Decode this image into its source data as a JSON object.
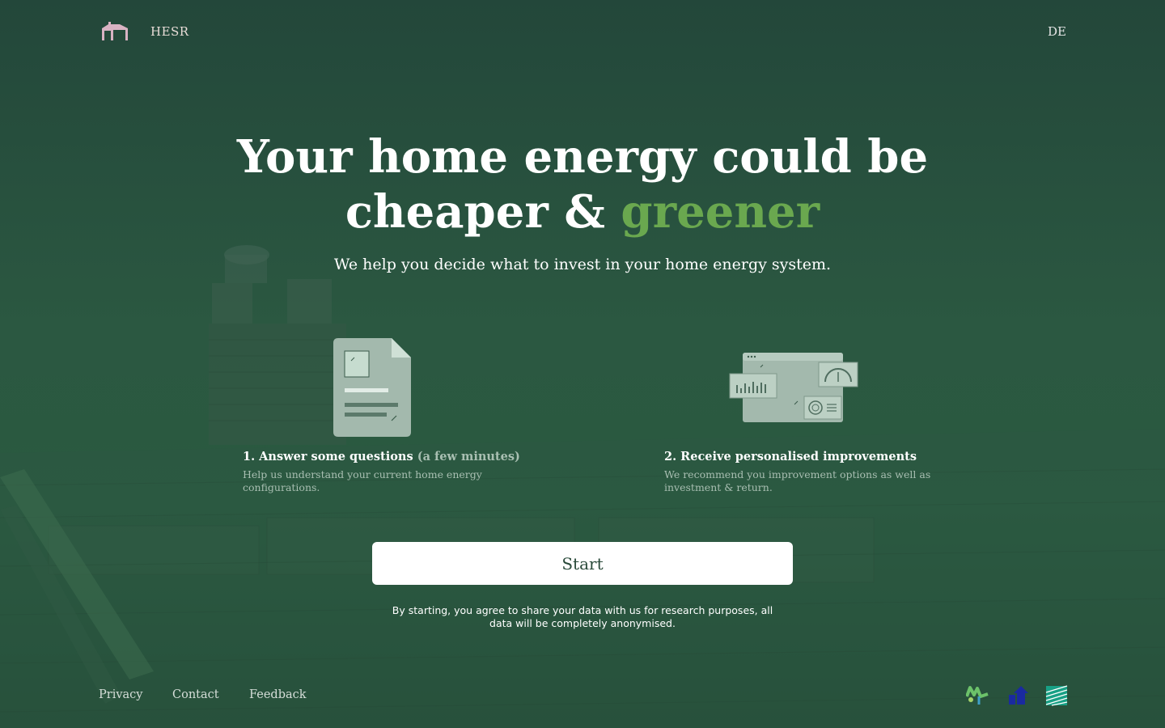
{
  "header": {
    "brand": "HESR",
    "logo_icon": "house-icon",
    "language_toggle": "DE"
  },
  "hero": {
    "title_line1": "Your home energy could be",
    "title_line2_prefix": "cheaper & ",
    "title_line2_highlight": "greener",
    "subtitle": "We help you decide what to invest in your home energy system.",
    "highlight_color": "#6aa84f"
  },
  "steps": [
    {
      "title": "1. Answer some questions",
      "title_suffix": "(a few minutes)",
      "description": "Help us understand your current home energy configurations.",
      "icon": "document-icon"
    },
    {
      "title": "2. Receive personalised improvements",
      "description": "We recommend you improvement options as well as investment & return.",
      "icon": "dashboard-icon"
    }
  ],
  "cta": {
    "start_label": "Start",
    "consent_text": "By starting, you agree to share your data with us for research purposes, all data will be completely anonymised."
  },
  "footer": {
    "links": [
      "Privacy",
      "Contact",
      "Feedback"
    ],
    "partner_logos": [
      "partner-logo-green-icon",
      "partner-logo-blue-icon",
      "partner-logo-stripes-icon"
    ]
  },
  "colors": {
    "background": "#254a3a",
    "accent_green": "#6aa84f",
    "logo_pink": "#d9b3c3",
    "button_text": "#2a4a3a"
  }
}
